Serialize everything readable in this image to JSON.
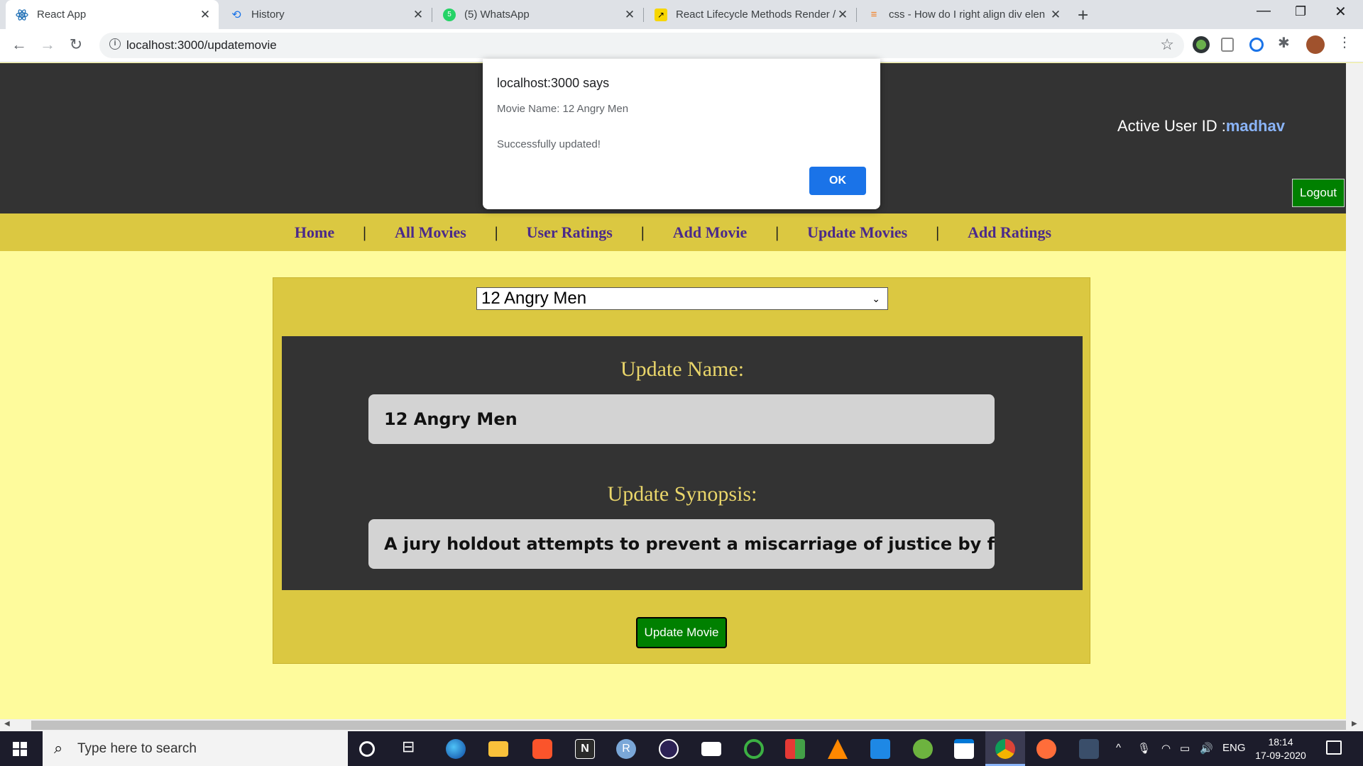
{
  "browser": {
    "tabs": [
      {
        "title": "React App",
        "icon": "react-icon",
        "active": true
      },
      {
        "title": "History",
        "icon": "history-icon",
        "active": false
      },
      {
        "title": "(5) WhatsApp",
        "icon": "whatsapp-icon",
        "active": false
      },
      {
        "title": "React Lifecycle Methods Render /",
        "icon": "page-icon",
        "active": false
      },
      {
        "title": "css - How do I right align div elen",
        "icon": "stackoverflow-icon",
        "active": false
      }
    ],
    "url": "localhost:3000/updatemovie"
  },
  "header": {
    "active_user_label": "Active User ID :",
    "active_user_id": "madhav",
    "logout_label": "Logout"
  },
  "nav": {
    "items": [
      "Home",
      "All Movies",
      "User Ratings",
      "Add Movie",
      "Update Movies",
      "Add Ratings"
    ],
    "separator": "|"
  },
  "form": {
    "selected_movie": "12 Angry Men",
    "name_label": "Update Name:",
    "name_value": "12 Angry Men",
    "synopsis_label": "Update Synopsis:",
    "synopsis_value": "A jury holdout attempts to prevent a miscarriage of justice by forc",
    "submit_label": "Update Movie"
  },
  "dialog": {
    "title": "localhost:3000 says",
    "message_line1": "Movie Name: 12 Angry Men",
    "message_line2": "Successfully updated!",
    "ok_label": "OK"
  },
  "taskbar": {
    "search_placeholder": "Type here to search",
    "language": "ENG",
    "time": "18:14",
    "date": "17-09-2020"
  },
  "colors": {
    "header_bg": "#333333",
    "nav_bg": "#dbc841",
    "page_bg": "#fefb9c",
    "nav_text": "#4b2a8a",
    "label_text": "#ead66a",
    "button_green": "#008000",
    "dialog_ok": "#1a73e8"
  }
}
